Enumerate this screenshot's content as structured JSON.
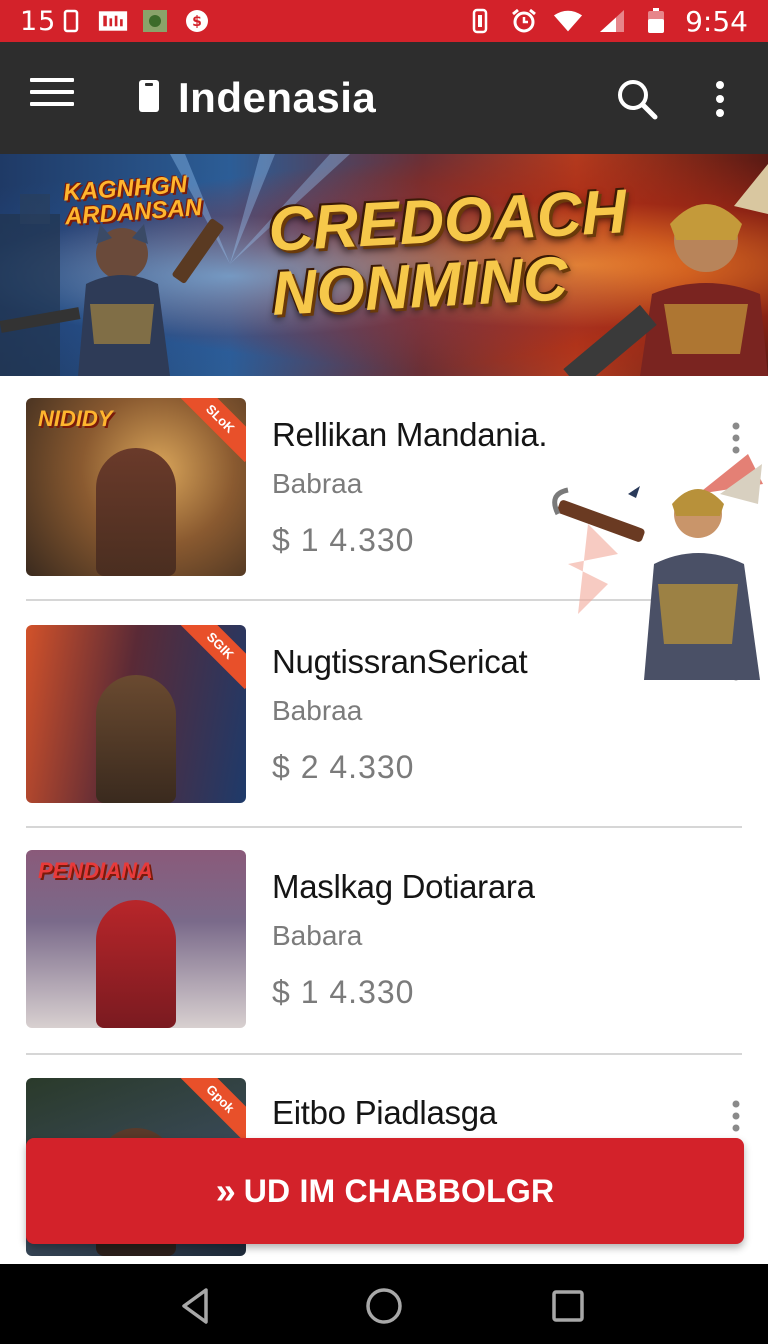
{
  "status_bar": {
    "left_text": "15",
    "clock": "9:54",
    "bg_color": "#d3222a",
    "icons_left": [
      "phone-outline-icon",
      "calendar-icon",
      "app-icon",
      "notification-icon"
    ],
    "icons_right": [
      "vibrate-icon",
      "alarm-icon",
      "wifi-icon",
      "signal-icon",
      "battery-icon"
    ]
  },
  "app_bar": {
    "title": "Indenasia",
    "bg_color": "#2d2d2d",
    "icons": [
      "menu-icon",
      "phone-icon",
      "search-icon",
      "more-vert-icon"
    ]
  },
  "banner": {
    "subtitle": "KAGNHGN ARDANSAN",
    "title": "CREDOACH NONMINC"
  },
  "list": {
    "items": [
      {
        "title": "Rellikan Mandania.",
        "subtitle": "Babraa",
        "price": "$ 1   4.330",
        "thumb_label": "NIDIDY",
        "corner_badge": "SLoK"
      },
      {
        "title": "NugtissranSericat",
        "subtitle": "Babraa",
        "price": "$ 2   4.330",
        "thumb_label": "",
        "corner_badge": "SGIK"
      },
      {
        "title": "Maslkag Dotiarara",
        "subtitle": "Babara",
        "price": "$ 1   4.330",
        "thumb_label": "PENDIANA",
        "corner_badge": ""
      },
      {
        "title": "Eitbo Piadlasga",
        "subtitle": "",
        "price": "",
        "thumb_label": "",
        "corner_badge": "Gpok"
      }
    ]
  },
  "cta": {
    "label": "UD IM CHABBOLGR",
    "icon": "double-chevron-right-icon",
    "bg_color": "#d3222a"
  },
  "nav_bar": {
    "icons": [
      "back-icon",
      "home-icon",
      "recents-icon"
    ]
  }
}
